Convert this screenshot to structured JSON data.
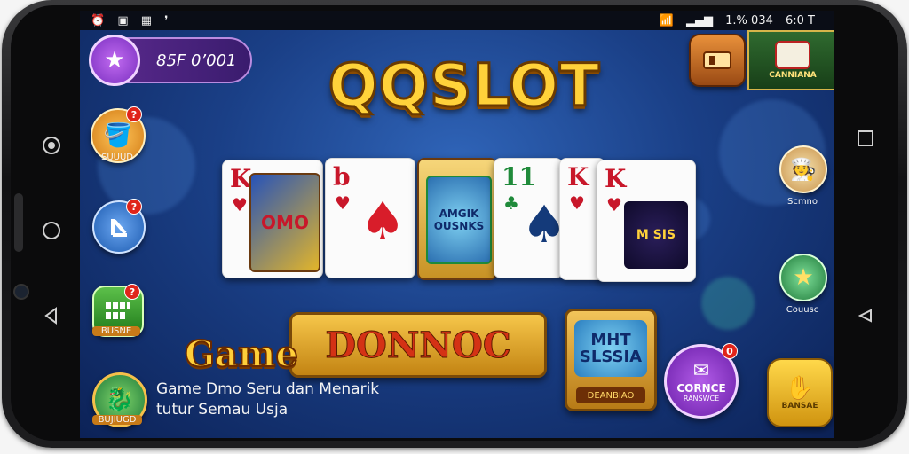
{
  "device": {
    "nav_left": [
      "home-circle",
      "circle",
      "back-triangle"
    ],
    "nav_right": [
      "square",
      "back-triangle"
    ]
  },
  "statusbar": {
    "left_icons": [
      "alarm",
      "cast",
      "gallery",
      "notification"
    ],
    "right_text": "1.% 034                                                                                                                                                                     ",
    "clock": "1.% 034",
    "end": "                  ",
    "time": "6:0 T"
  },
  "header": {
    "balance": "85F 0’001",
    "logo": "QQSLOT"
  },
  "cards": [
    {
      "rank": "K",
      "art": "OMO",
      "color": "#c8172a"
    },
    {
      "rank": "b",
      "color": "#c8172a"
    },
    {
      "art": "AMGIK OUSNKS"
    },
    {
      "rank": "11",
      "color": "#1f8a3a"
    },
    {
      "rank": "K",
      "color": "#c8172a"
    },
    {
      "rank": "K",
      "art": "M SIS",
      "color": "#c8172a"
    }
  ],
  "left_buttons": [
    {
      "label": "SUUUD",
      "badge": "?"
    },
    {
      "label": "",
      "badge": "?"
    },
    {
      "label": "BUSNE",
      "badge": "?"
    },
    {
      "label": "BUJIUGD",
      "badge": ""
    }
  ],
  "right_buttons": [
    {
      "label": "Scmno"
    },
    {
      "label": "Couusc"
    }
  ],
  "top_right": {
    "badge_label": "CANNIANA"
  },
  "bottom": {
    "game_word": "Game",
    "banner": "DONNOC",
    "desc_line1": "Game Dmo Seru dan Menarik",
    "desc_line2": "tutur Semau Usja",
    "mht_title": "MHT SLSSIA",
    "mht_label": "DEANBIAO",
    "purple_title": "CORNCE",
    "purple_sub": "RANSWCE",
    "purple_badge": "0",
    "yellow_label": "BANSAE"
  }
}
